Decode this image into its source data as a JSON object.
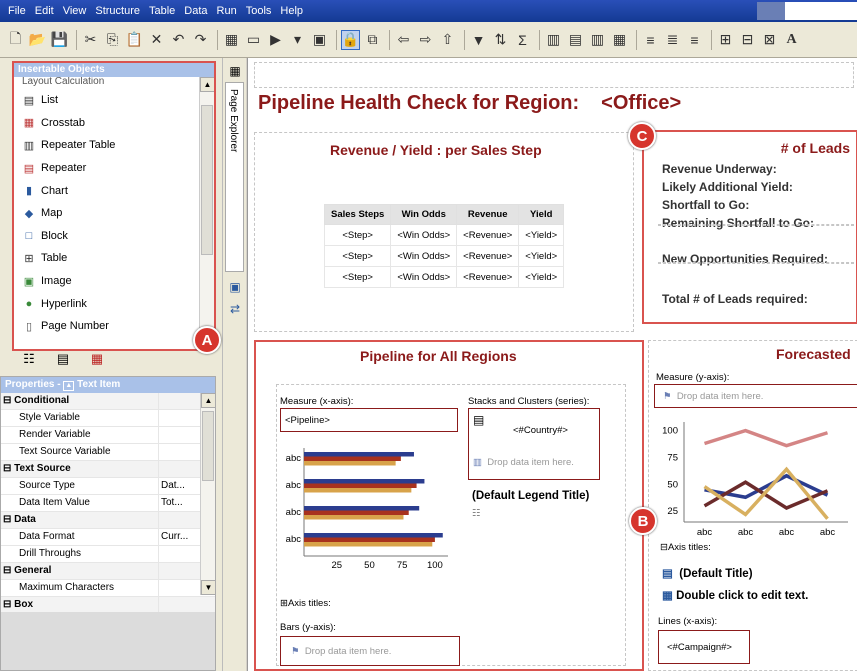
{
  "menu": [
    "File",
    "Edit",
    "View",
    "Structure",
    "Table",
    "Data",
    "Run",
    "Tools",
    "Help"
  ],
  "toolbar_icons": [
    "new-icon",
    "open-icon",
    "save-icon",
    "sep",
    "cut-icon",
    "copy-icon",
    "paste-icon",
    "delete-icon",
    "undo-icon",
    "redo-icon",
    "sep",
    "report-icon",
    "xml-icon",
    "run-icon",
    "dropdown-icon",
    "view-icon",
    "sep",
    "lock-icon",
    "move-icon",
    "sep",
    "left-arrow-icon",
    "right-arrow-icon",
    "up-arrow-icon",
    "sep",
    "filter-icon",
    "sort-icon",
    "summary-icon",
    "sep",
    "group-icon",
    "align-left-icon",
    "align-center-icon",
    "align-right-icon",
    "sep",
    "text-left-icon",
    "text-center-icon",
    "text-right-icon",
    "sep",
    "table-icon",
    "merge-icon",
    "split-icon",
    "font-icon"
  ],
  "insertable_objects": {
    "title": "Insertable Objects",
    "partial_item": "Layout Calculation",
    "items": [
      {
        "label": "List",
        "icon": "list-icon"
      },
      {
        "label": "Crosstab",
        "icon": "crosstab-icon"
      },
      {
        "label": "Repeater Table",
        "icon": "repeater-table-icon"
      },
      {
        "label": "Repeater",
        "icon": "repeater-icon"
      },
      {
        "label": "Chart",
        "icon": "chart-icon"
      },
      {
        "label": "Map",
        "icon": "map-icon"
      },
      {
        "label": "Block",
        "icon": "block-icon"
      },
      {
        "label": "Table",
        "icon": "table-icon"
      },
      {
        "label": "Image",
        "icon": "image-icon"
      },
      {
        "label": "Hyperlink",
        "icon": "hyperlink-icon"
      },
      {
        "label": "Page Number",
        "icon": "page-number-icon"
      }
    ]
  },
  "properties": {
    "title": "Properties - ",
    "subtitle": "Text Item",
    "rows": [
      {
        "name": "Conditional",
        "value": "",
        "section": true
      },
      {
        "name": "Style Variable",
        "value": "",
        "section": false
      },
      {
        "name": "Render Variable",
        "value": "",
        "section": false
      },
      {
        "name": "Text Source Variable",
        "value": "",
        "section": false
      },
      {
        "name": "Text Source",
        "value": "",
        "section": true
      },
      {
        "name": "Source Type",
        "value": "Dat...",
        "section": false
      },
      {
        "name": "Data Item Value",
        "value": "Tot...",
        "section": false
      },
      {
        "name": "Data",
        "value": "",
        "section": true
      },
      {
        "name": "Data Format",
        "value": "Curr...",
        "section": false
      },
      {
        "name": "Drill Throughs",
        "value": "",
        "section": false
      },
      {
        "name": "General",
        "value": "",
        "section": true
      },
      {
        "name": "Maximum Characters",
        "value": "",
        "section": false
      },
      {
        "name": "Box",
        "value": "",
        "section": true
      }
    ]
  },
  "page_explorer_label": "Page Explorer",
  "report": {
    "title": "Pipeline Health Check for Region:",
    "office": "<Office>",
    "revenue_yield": {
      "heading": "Revenue / Yield : per Sales Step",
      "headers": [
        "Sales Steps",
        "Win Odds",
        "Revenue",
        "Yield"
      ],
      "rows": [
        [
          "<Step>",
          "<Win Odds>",
          "<Revenue>",
          "<Yield>"
        ],
        [
          "<Step>",
          "<Win Odds>",
          "<Revenue>",
          "<Yield>"
        ],
        [
          "<Step>",
          "<Win Odds>",
          "<Revenue>",
          "<Yield>"
        ]
      ]
    },
    "leads": {
      "heading": "# of Leads",
      "lines": [
        "Revenue Underway:",
        "Likely Additional Yield:",
        "Shortfall to Go:",
        "Remaining Shortfall to Go:",
        "New Opportunities Required:",
        "Total # of Leads required:"
      ]
    },
    "pipeline": {
      "heading": "Pipeline for All Regions",
      "measure_label": "Measure (x-axis):",
      "measure_value": "<Pipeline>",
      "stacks_label": "Stacks and Clusters (series):",
      "stacks_value": "<#Country#>",
      "drop_label": "Drop data item here.",
      "legend_title": "(Default Legend Title)",
      "axis_titles": "Axis titles:",
      "bars_label": "Bars (y-axis):",
      "bars_drop": "Drop data item here."
    },
    "forecasted": {
      "heading": "Forecasted",
      "measure_label": "Measure (y-axis):",
      "drop_label": "Drop data item here.",
      "axis_titles": "Axis titles:",
      "default_title": "(Default Title)",
      "edit_text": "Double click to edit text.",
      "lines_label": "Lines (x-axis):",
      "lines_value": "<#Campaign#>"
    }
  },
  "badges": {
    "a": "A",
    "b": "B",
    "c": "C"
  },
  "chart_data": [
    {
      "type": "bar",
      "orientation": "horizontal",
      "categories": [
        "abc",
        "abc",
        "abc",
        "abc"
      ],
      "series": [
        {
          "values": [
            84,
            92,
            88,
            106
          ],
          "color": "#2b3d8f"
        },
        {
          "values": [
            74,
            86,
            80,
            100
          ],
          "color": "#a8321e"
        },
        {
          "values": [
            70,
            82,
            76,
            98
          ],
          "color": "#d8a34a"
        }
      ],
      "xticks": [
        25,
        50,
        75,
        100
      ],
      "xlim": [
        0,
        110
      ]
    },
    {
      "type": "line",
      "categories": [
        "abc",
        "abc",
        "abc",
        "abc"
      ],
      "series": [
        {
          "values": [
            88,
            100,
            86,
            98
          ],
          "color": "#d48585"
        },
        {
          "values": [
            45,
            38,
            58,
            40
          ],
          "color": "#2b3d8f"
        },
        {
          "values": [
            30,
            52,
            28,
            44
          ],
          "color": "#6b2b2b"
        },
        {
          "values": [
            48,
            22,
            64,
            18
          ],
          "color": "#d8b060"
        }
      ],
      "yticks": [
        25,
        50,
        75,
        100
      ],
      "ylim": [
        15,
        108
      ]
    }
  ]
}
